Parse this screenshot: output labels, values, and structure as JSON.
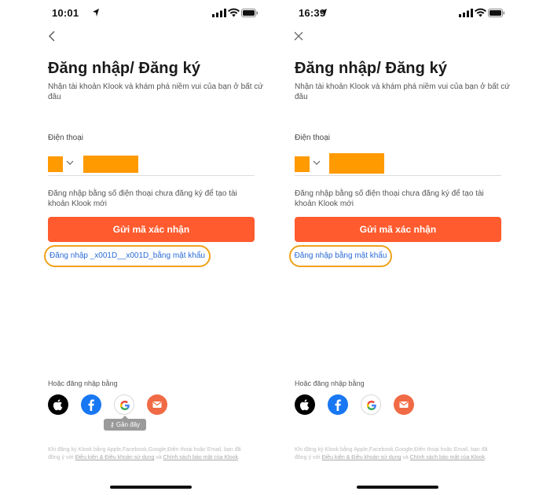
{
  "colors": {
    "accent": "#ff5b2e",
    "link": "#2a6bd8",
    "highlight": "#f0a21a",
    "redaction": "#ff9a00",
    "facebook": "#1877f2",
    "email": "#f06b45"
  },
  "screens": [
    {
      "status_time": "10:01",
      "nav_icon": "back-arrow-icon",
      "title": "Đăng nhập/ Đăng ký",
      "subtitle": "Nhận tài khoản Klook và khám phá niềm vui của bạn ở bất cứ đâu",
      "phone_label": "Điện thoại",
      "hint": "Đăng nhập bằng số điện thoại chưa đăng ký để tạo tài khoản Klook mới",
      "send_button": "Gửi mã xác nhận",
      "password_link": "Đăng nhập _x001D__x001D_bằng mật khẩu",
      "or_label": "Hoặc đăng nhập bằng",
      "tooltip": "Gần đây",
      "legal_prefix": "Khi đăng ký Klook bằng Apple,Facebook,Google,Điện thoại hoặc Email, bạn đã đồng ý với ",
      "legal_terms": "Điều kiện & Điều khoản sử dụng",
      "legal_and": " và ",
      "legal_privacy": "Chính sách bảo mật của Klook",
      "legal_end": "."
    },
    {
      "status_time": "16:39",
      "nav_icon": "close-icon",
      "title": "Đăng nhập/ Đăng ký",
      "subtitle": "Nhận tài khoản Klook và khám phá niềm vui của bạn ở bất cứ đâu",
      "phone_label": "Điện thoại",
      "hint": "Đăng nhập bằng số điện thoại chưa đăng ký để tạo tài khoản Klook mới",
      "send_button": "Gửi mã xác nhận",
      "password_link": "Đăng nhập bằng mật khẩu",
      "or_label": "Hoặc đăng nhập bằng",
      "legal_prefix": "Khi đăng ký Klook bằng Apple,Facebook,Google,Điện thoại hoặc Email, bạn đã đồng ý với ",
      "legal_terms": "Điều kiện & Điều khoản sử dụng",
      "legal_and": " và ",
      "legal_privacy": "Chính sách bảo mật của Klook",
      "legal_end": "."
    }
  ]
}
